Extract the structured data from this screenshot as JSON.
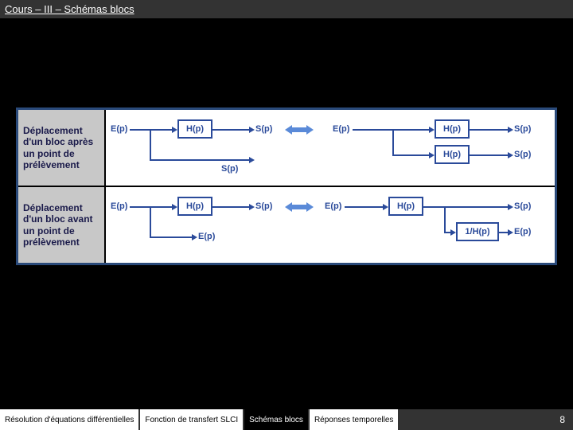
{
  "header": {
    "title": "Cours – III – Schémas blocs"
  },
  "rows": [
    {
      "label": "Déplacement d'un bloc après un point de prélèvement"
    },
    {
      "label": "Déplacement d'un bloc avant un point de prélèvement"
    }
  ],
  "signals": {
    "E": "E(p)",
    "S": "S(p)",
    "H": "H(p)",
    "invH": "1/H(p)"
  },
  "tabs": [
    {
      "label": "Résolution d'équations différentielles",
      "active": false
    },
    {
      "label": "Fonction de transfert SLCI",
      "active": false
    },
    {
      "label": "Schémas blocs",
      "active": true
    },
    {
      "label": "Réponses temporelles",
      "active": false
    }
  ],
  "page": "8"
}
